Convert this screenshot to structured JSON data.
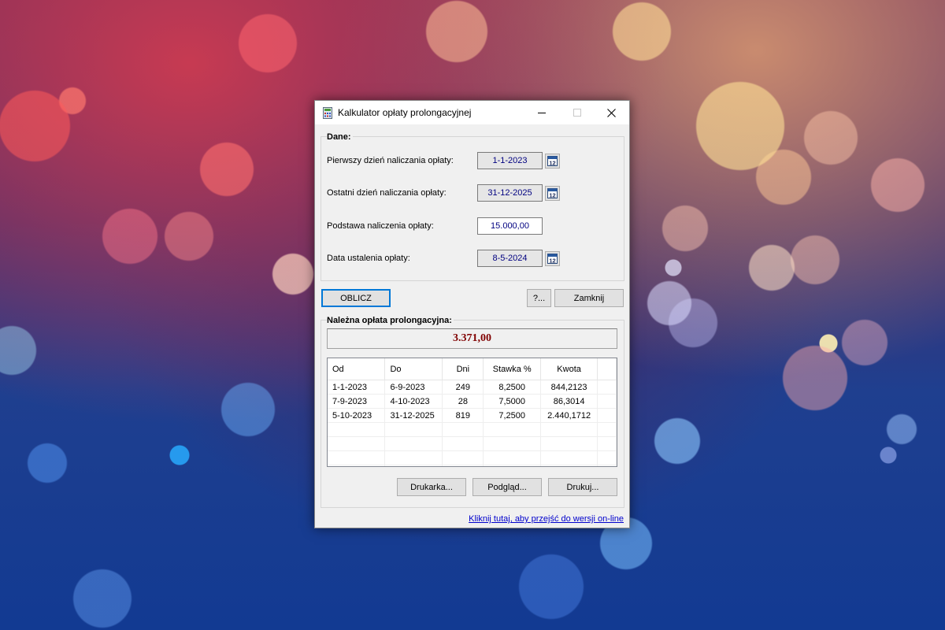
{
  "window": {
    "title": "Kalkulator opłaty prolongacyjnej"
  },
  "dane": {
    "group_label": "Dane:",
    "first_day": {
      "label": "Pierwszy dzień naliczania opłaty:",
      "value": "1-1-2023"
    },
    "last_day": {
      "label": "Ostatni dzień naliczania opłaty:",
      "value": "31-12-2025"
    },
    "base": {
      "label": "Podstawa naliczenia opłaty:",
      "value": "15.000,00"
    },
    "set_date": {
      "label": "Data ustalenia opłaty:",
      "value": "8-5-2024"
    },
    "calendar_icon_text": "12"
  },
  "buttons": {
    "calculate": "OBLICZ",
    "help": "?...",
    "close": "Zamknij",
    "printer": "Drukarka...",
    "preview": "Podgląd...",
    "print": "Drukuj..."
  },
  "result": {
    "group_label": "Należna opłata prolongacyjna:",
    "total": "3.371,00"
  },
  "table": {
    "columns": [
      "Od",
      "Do",
      "Dni",
      "Stawka %",
      "Kwota"
    ],
    "rows": [
      [
        "1-1-2023",
        "6-9-2023",
        "249",
        "8,2500",
        "844,2123"
      ],
      [
        "7-9-2023",
        "4-10-2023",
        "28",
        "7,5000",
        "86,3014"
      ],
      [
        "5-10-2023",
        "31-12-2025",
        "819",
        "7,2500",
        "2.440,1712"
      ]
    ]
  },
  "footer": {
    "online_link": "Kliknij tutaj, aby przejść do wersji on-line"
  },
  "colors": {
    "result_text": "#800000",
    "field_text": "#000080",
    "default_button_border": "#0078d7",
    "link": "#0000cc"
  },
  "icons": {
    "app": "calculator-app-icon",
    "calendar": "calendar-icon",
    "minimize": "minimize-icon",
    "maximize": "maximize-icon",
    "close": "close-icon"
  }
}
